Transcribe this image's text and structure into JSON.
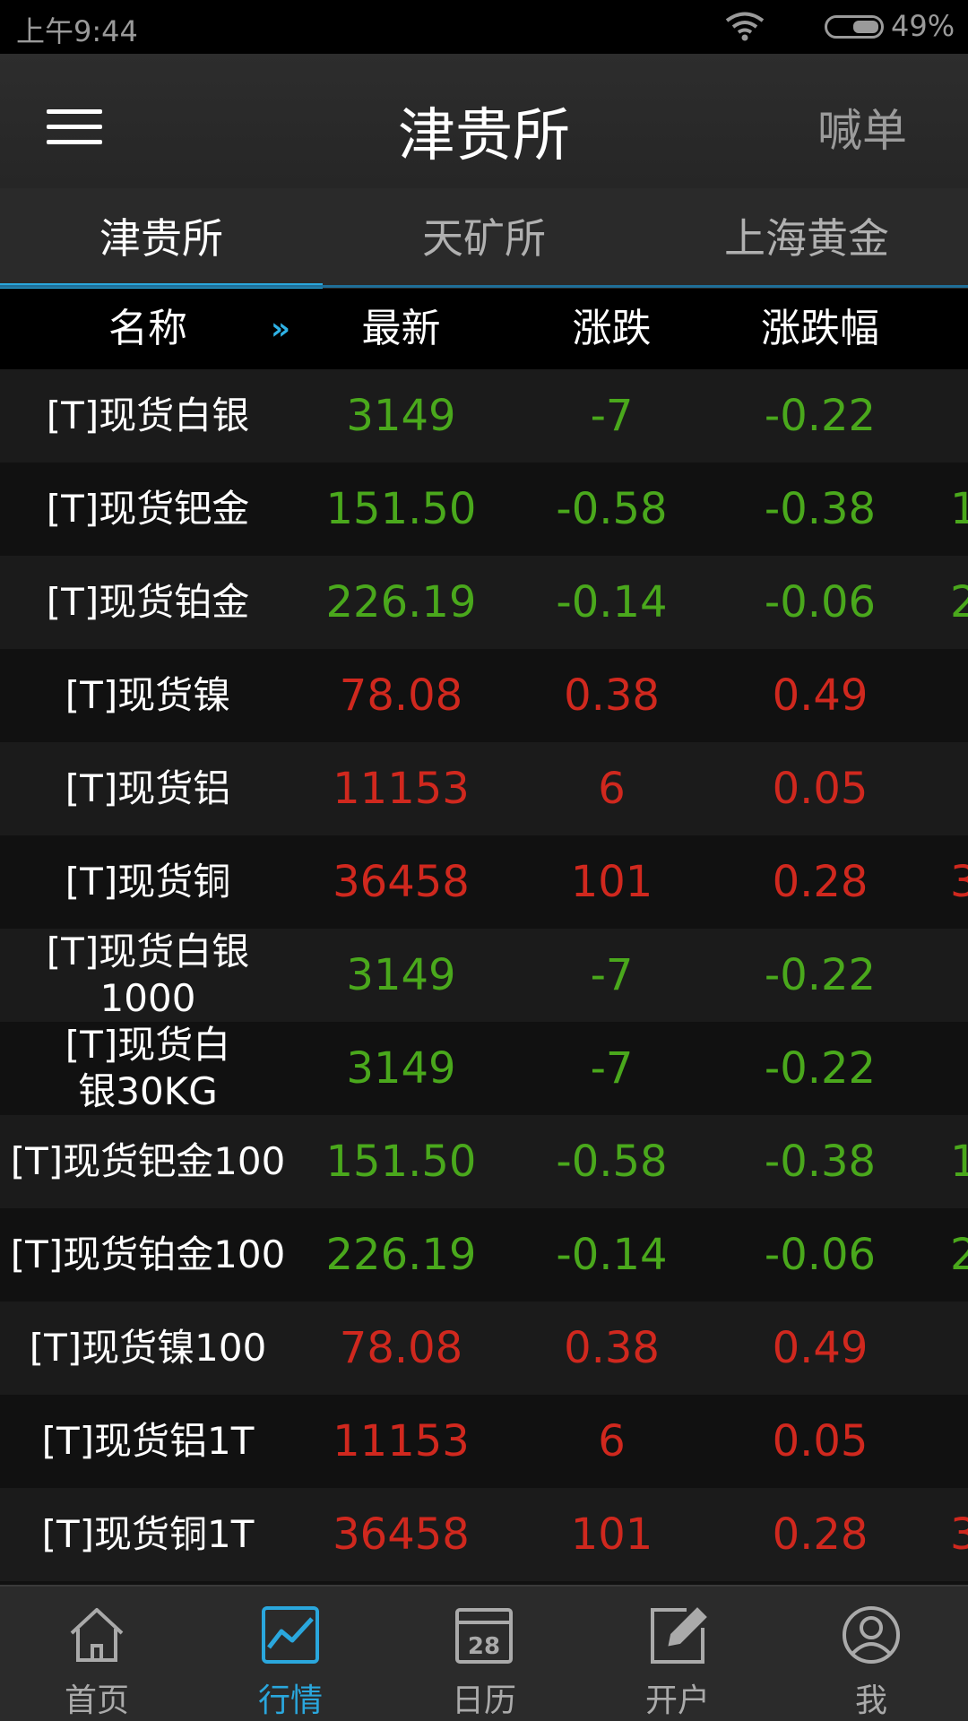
{
  "status": {
    "time": "上午9:44",
    "battery": "49%"
  },
  "header": {
    "title": "津贵所",
    "action": "喊单",
    "menu_icon": "menu-icon"
  },
  "tabs": [
    {
      "label": "津贵所",
      "active": true
    },
    {
      "label": "天矿所",
      "active": false
    },
    {
      "label": "上海黄金",
      "active": false
    }
  ],
  "columns": {
    "name": "名称",
    "arrows": "»",
    "latest": "最新",
    "change": "涨跌",
    "pct": "涨跌幅"
  },
  "rows": [
    {
      "name": "[T]现货白银",
      "latest": "3149",
      "change": "-7",
      "pct": "-0.22",
      "dir": "down",
      "extra": ""
    },
    {
      "name": "[T]现货钯金",
      "latest": "151.50",
      "change": "-0.58",
      "pct": "-0.38",
      "dir": "down",
      "extra": "1"
    },
    {
      "name": "[T]现货铂金",
      "latest": "226.19",
      "change": "-0.14",
      "pct": "-0.06",
      "dir": "down",
      "extra": "2"
    },
    {
      "name": "[T]现货镍",
      "latest": "78.08",
      "change": "0.38",
      "pct": "0.49",
      "dir": "up",
      "extra": ""
    },
    {
      "name": "[T]现货铝",
      "latest": "11153",
      "change": "6",
      "pct": "0.05",
      "dir": "up",
      "extra": ""
    },
    {
      "name": "[T]现货铜",
      "latest": "36458",
      "change": "101",
      "pct": "0.28",
      "dir": "up",
      "extra": "3"
    },
    {
      "name": "[T]现货白银1000",
      "latest": "3149",
      "change": "-7",
      "pct": "-0.22",
      "dir": "down",
      "extra": ""
    },
    {
      "name": "[T]现货白银30KG",
      "latest": "3149",
      "change": "-7",
      "pct": "-0.22",
      "dir": "down",
      "extra": ""
    },
    {
      "name": "[T]现货钯金100",
      "latest": "151.50",
      "change": "-0.58",
      "pct": "-0.38",
      "dir": "down",
      "extra": "1"
    },
    {
      "name": "[T]现货铂金100",
      "latest": "226.19",
      "change": "-0.14",
      "pct": "-0.06",
      "dir": "down",
      "extra": "2"
    },
    {
      "name": "[T]现货镍100",
      "latest": "78.08",
      "change": "0.38",
      "pct": "0.49",
      "dir": "up",
      "extra": ""
    },
    {
      "name": "[T]现货铝1T",
      "latest": "11153",
      "change": "6",
      "pct": "0.05",
      "dir": "up",
      "extra": ""
    },
    {
      "name": "[T]现货铜1T",
      "latest": "36458",
      "change": "101",
      "pct": "0.28",
      "dir": "up",
      "extra": "3"
    }
  ],
  "nav": [
    {
      "label": "首页",
      "icon": "home-icon",
      "active": false
    },
    {
      "label": "行情",
      "icon": "chart-icon",
      "active": true
    },
    {
      "label": "日历",
      "icon": "calendar-icon",
      "active": false,
      "day": "28"
    },
    {
      "label": "开户",
      "icon": "edit-icon",
      "active": false
    },
    {
      "label": "我",
      "icon": "user-icon",
      "active": false
    }
  ],
  "colors": {
    "up": "#d0281e",
    "down": "#4aa81c",
    "accent": "#2aa7dd"
  }
}
